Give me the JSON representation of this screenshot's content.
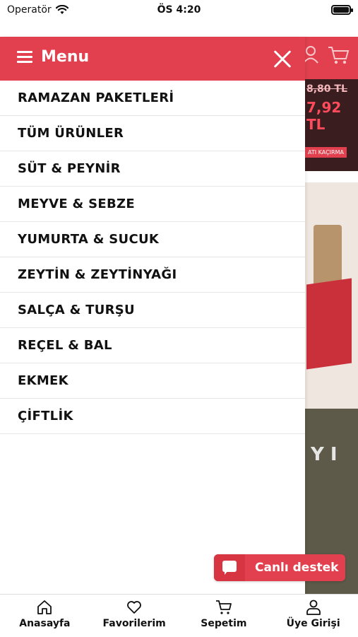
{
  "status_bar": {
    "carrier": "Operatör",
    "time": "ÖS 4:20"
  },
  "background": {
    "old_price": "8,80 TL",
    "new_price": "7,92 TL",
    "promo_tag": "ATI KAÇIRMA",
    "photo_letters": "Y I"
  },
  "drawer": {
    "title": "Menu",
    "items": [
      "RAMAZAN PAKETLERİ",
      "TÜM ÜRÜNLER",
      "SÜT & PEYNİR",
      "MEYVE & SEBZE",
      "YUMURTA & SUCUK",
      "ZEYTİN & ZEYTİNYAĞI",
      "SALÇA & TURŞU",
      "REÇEL & BAL",
      "EKMEK",
      "ÇİFTLİK"
    ]
  },
  "live_support": {
    "label": "Canlı destek"
  },
  "tabbar": {
    "home": "Anasayfa",
    "favorites": "Favorilerim",
    "cart": "Sepetim",
    "login": "Üye Girişi"
  },
  "colors": {
    "accent": "#e2404e"
  }
}
